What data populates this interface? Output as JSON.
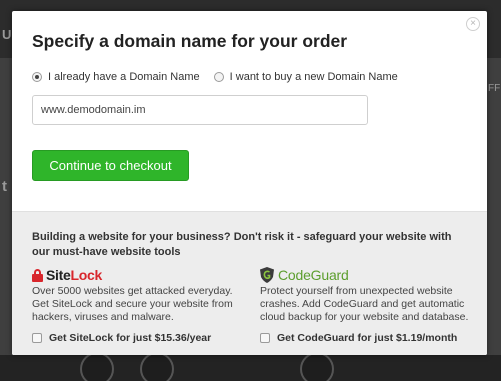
{
  "background": {
    "top_left_glyph": "U",
    "top_right_text": "FF",
    "left_glyph": "t"
  },
  "modal": {
    "title": "Specify a domain name for your order",
    "close_glyph": "×",
    "radio_options": [
      {
        "label": "I already have a Domain Name",
        "checked": true
      },
      {
        "label": "I want to buy a new Domain Name",
        "checked": false
      }
    ],
    "domain_input": {
      "value": "www.demodomain.im"
    },
    "checkout_button": "Continue to checkout"
  },
  "promo": {
    "heading": "Building a website for your business? Don't risk it - safeguard your website with our must-have website tools",
    "sitelock": {
      "logo_part1": "Site",
      "logo_part2": "Lock",
      "description": "Over 5000 websites get attacked everyday. Get SiteLock and secure your website from hackers, viruses and malware.",
      "checkbox_label": "Get SiteLock for just $15.36/year"
    },
    "codeguard": {
      "logo": "CodeGuard",
      "description": "Protect yourself from unexpected website crashes. Add CodeGuard and get automatic cloud backup for your website and database.",
      "checkbox_label": "Get CodeGuard for just $1.19/month"
    }
  },
  "colors": {
    "accent_green": "#2fb52a",
    "sitelock_red": "#d8262c",
    "codeguard_green": "#5c9e2d"
  }
}
